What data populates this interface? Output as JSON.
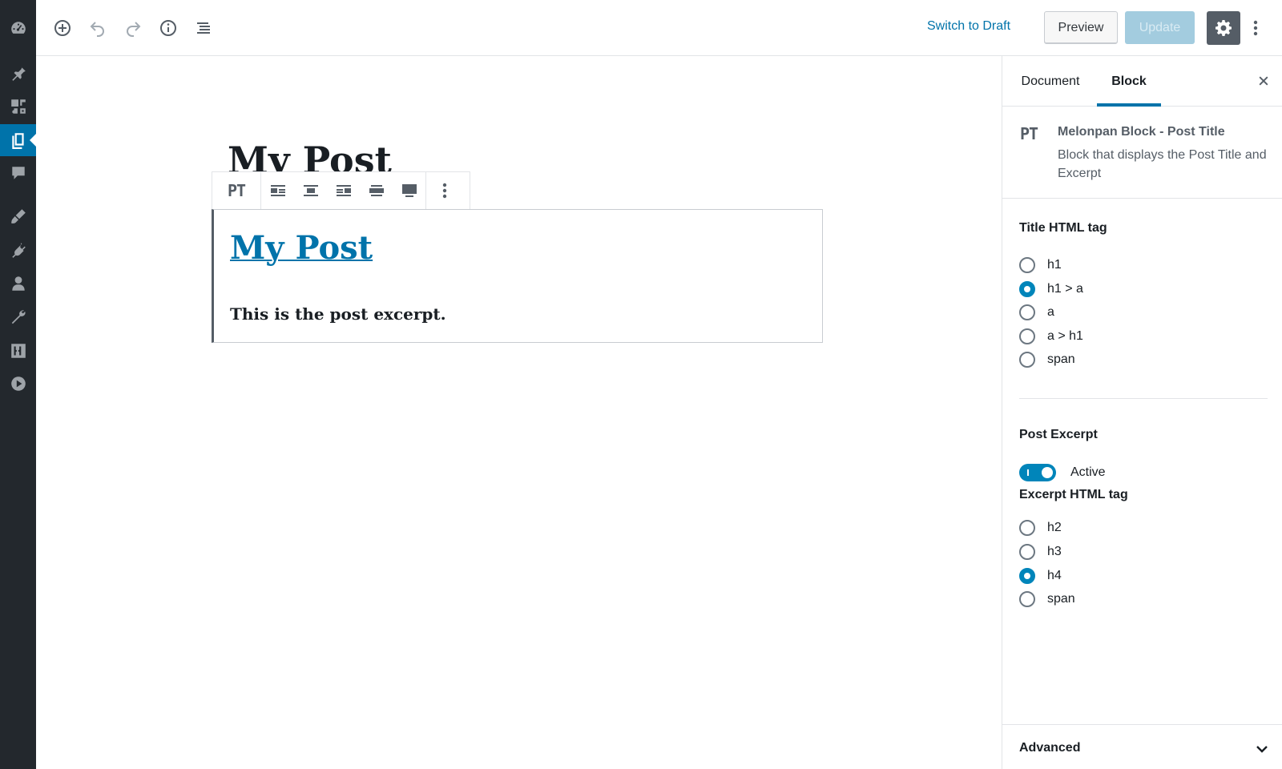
{
  "admin_menu": {
    "items": [
      {
        "icon": "dashboard-icon"
      },
      {
        "icon": "pin-icon"
      },
      {
        "icon": "media-icon"
      },
      {
        "icon": "pages-icon",
        "active": true
      },
      {
        "icon": "comments-icon"
      },
      {
        "icon": "appearance-icon"
      },
      {
        "icon": "plugins-icon"
      },
      {
        "icon": "users-icon"
      },
      {
        "icon": "tools-icon"
      },
      {
        "icon": "settings-sliders-icon"
      },
      {
        "icon": "play-icon"
      }
    ]
  },
  "toolbar": {
    "switch_draft_label": "Switch to Draft",
    "preview_label": "Preview",
    "update_label": "Update"
  },
  "editor": {
    "post_title": "My Post",
    "block": {
      "icon_text": "PT",
      "title": "My Post",
      "excerpt": "This is the post excerpt."
    }
  },
  "sidebar": {
    "tabs": [
      {
        "label": "Document"
      },
      {
        "label": "Block",
        "active": true
      }
    ],
    "block_card": {
      "icon_text": "PT",
      "title": "Melonpan Block - Post Title",
      "description": "Block that displays the Post Title and Excerpt"
    },
    "title_tag": {
      "heading": "Title HTML tag",
      "options": [
        "h1",
        "h1 > a",
        "a",
        "a > h1",
        "span"
      ],
      "selected": "h1 > a"
    },
    "post_excerpt": {
      "heading": "Post Excerpt",
      "toggle_label": "Active",
      "toggle_on": true
    },
    "excerpt_tag": {
      "heading": "Excerpt HTML tag",
      "options": [
        "h2",
        "h3",
        "h4",
        "span"
      ],
      "selected": "h4"
    },
    "advanced_label": "Advanced"
  },
  "colors": {
    "accent": "#0073aa",
    "admin_bg": "#23282d",
    "radio_checked": "#0085ba"
  }
}
